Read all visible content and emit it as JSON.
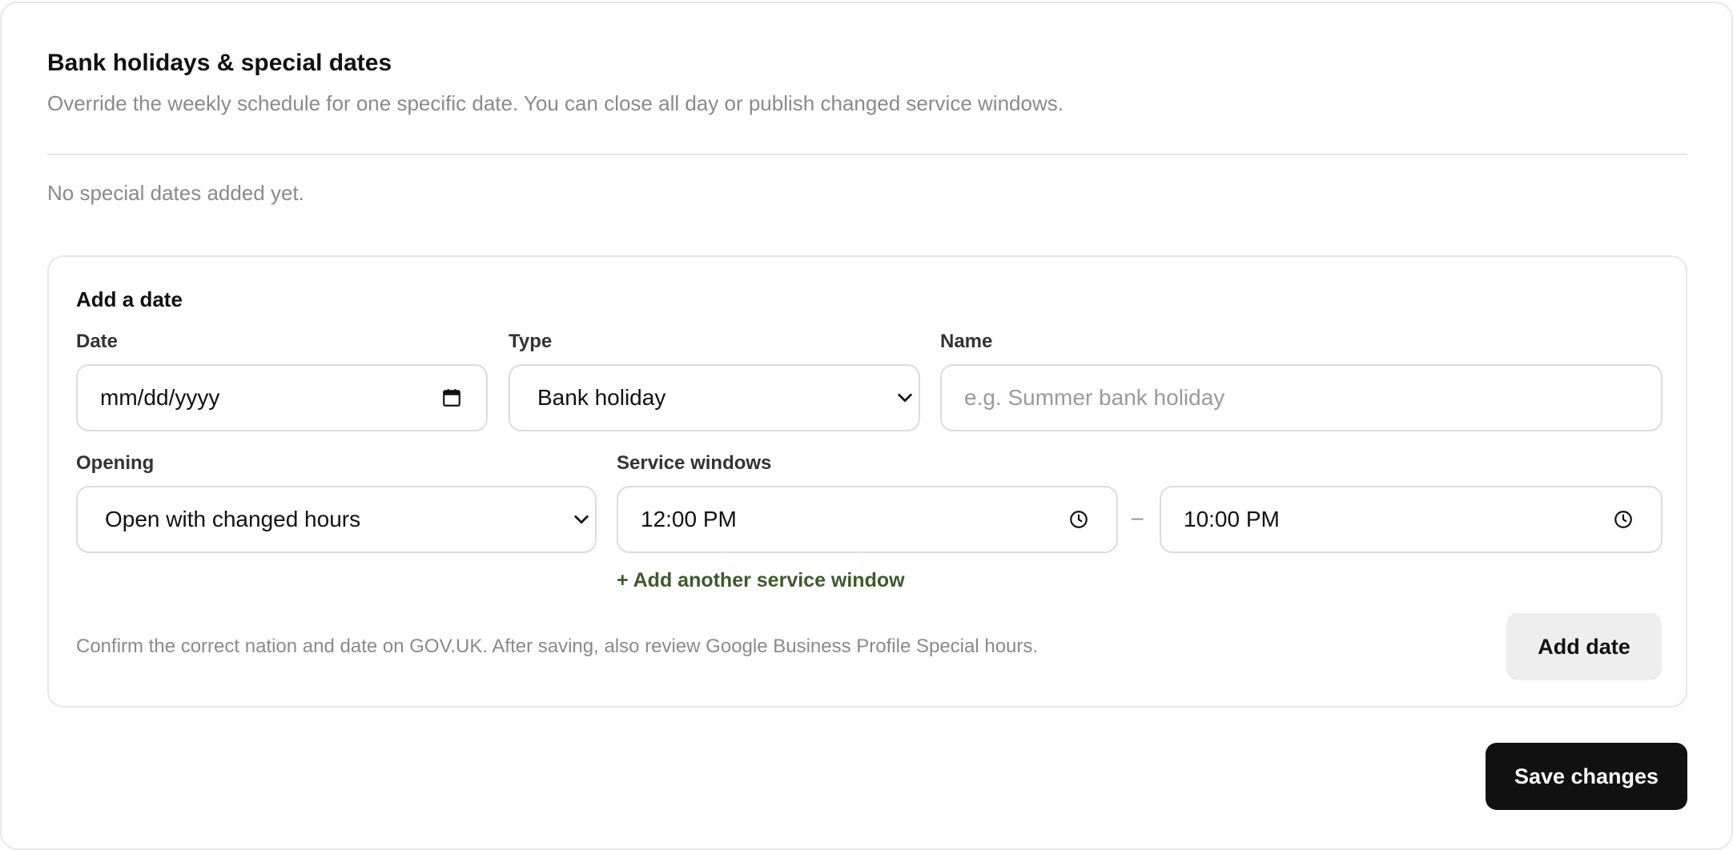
{
  "section": {
    "title": "Bank holidays & special dates",
    "subtitle": "Override the weekly schedule for one specific date. You can close all day or publish changed service windows.",
    "empty_state": "No special dates added yet."
  },
  "add_form": {
    "heading": "Add a date",
    "date": {
      "label": "Date",
      "placeholder": "mm/dd/yyyy",
      "icon": "calendar-icon"
    },
    "type": {
      "label": "Type",
      "selected": "Bank holiday",
      "icon": "chevron-down-icon"
    },
    "name": {
      "label": "Name",
      "placeholder": "e.g. Summer bank holiday"
    },
    "opening": {
      "label": "Opening",
      "selected": "Open with changed hours",
      "icon": "chevron-down-icon"
    },
    "service_windows": {
      "label": "Service windows",
      "start": "12:00 PM",
      "end": "10:00 PM",
      "separator": "–",
      "icon": "clock-icon",
      "add_link": "+ Add another service window"
    },
    "note": "Confirm the correct nation and date on GOV.UK. After saving, also review Google Business Profile Special hours.",
    "add_button": "Add date"
  },
  "save_button": "Save changes",
  "colors": {
    "link_green": "#3d5a2a",
    "save_bg": "#111111",
    "add_bg": "#eeeeee",
    "muted_text": "#8a8a8a",
    "border": "#dcdcdc"
  }
}
